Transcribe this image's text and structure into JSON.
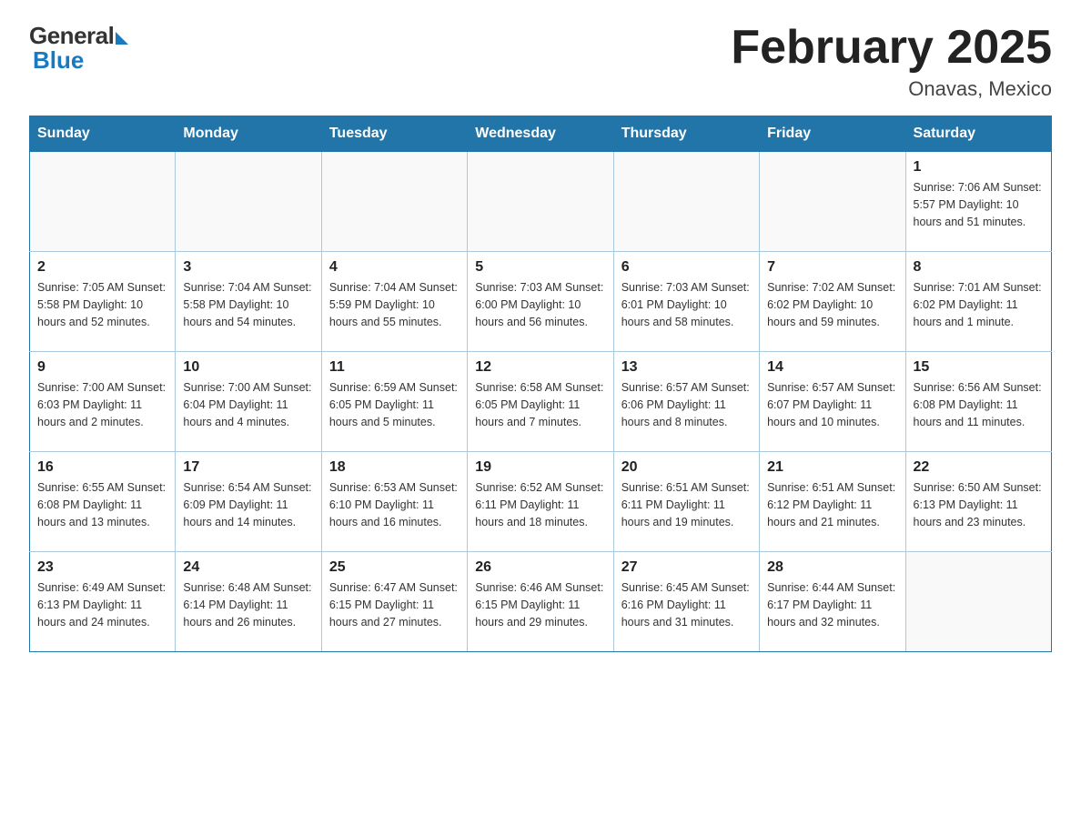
{
  "header": {
    "logo_general": "General",
    "logo_blue": "Blue",
    "month_title": "February 2025",
    "location": "Onavas, Mexico"
  },
  "days_of_week": [
    "Sunday",
    "Monday",
    "Tuesday",
    "Wednesday",
    "Thursday",
    "Friday",
    "Saturday"
  ],
  "weeks": [
    [
      {
        "day": "",
        "info": ""
      },
      {
        "day": "",
        "info": ""
      },
      {
        "day": "",
        "info": ""
      },
      {
        "day": "",
        "info": ""
      },
      {
        "day": "",
        "info": ""
      },
      {
        "day": "",
        "info": ""
      },
      {
        "day": "1",
        "info": "Sunrise: 7:06 AM\nSunset: 5:57 PM\nDaylight: 10 hours\nand 51 minutes."
      }
    ],
    [
      {
        "day": "2",
        "info": "Sunrise: 7:05 AM\nSunset: 5:58 PM\nDaylight: 10 hours\nand 52 minutes."
      },
      {
        "day": "3",
        "info": "Sunrise: 7:04 AM\nSunset: 5:58 PM\nDaylight: 10 hours\nand 54 minutes."
      },
      {
        "day": "4",
        "info": "Sunrise: 7:04 AM\nSunset: 5:59 PM\nDaylight: 10 hours\nand 55 minutes."
      },
      {
        "day": "5",
        "info": "Sunrise: 7:03 AM\nSunset: 6:00 PM\nDaylight: 10 hours\nand 56 minutes."
      },
      {
        "day": "6",
        "info": "Sunrise: 7:03 AM\nSunset: 6:01 PM\nDaylight: 10 hours\nand 58 minutes."
      },
      {
        "day": "7",
        "info": "Sunrise: 7:02 AM\nSunset: 6:02 PM\nDaylight: 10 hours\nand 59 minutes."
      },
      {
        "day": "8",
        "info": "Sunrise: 7:01 AM\nSunset: 6:02 PM\nDaylight: 11 hours\nand 1 minute."
      }
    ],
    [
      {
        "day": "9",
        "info": "Sunrise: 7:00 AM\nSunset: 6:03 PM\nDaylight: 11 hours\nand 2 minutes."
      },
      {
        "day": "10",
        "info": "Sunrise: 7:00 AM\nSunset: 6:04 PM\nDaylight: 11 hours\nand 4 minutes."
      },
      {
        "day": "11",
        "info": "Sunrise: 6:59 AM\nSunset: 6:05 PM\nDaylight: 11 hours\nand 5 minutes."
      },
      {
        "day": "12",
        "info": "Sunrise: 6:58 AM\nSunset: 6:05 PM\nDaylight: 11 hours\nand 7 minutes."
      },
      {
        "day": "13",
        "info": "Sunrise: 6:57 AM\nSunset: 6:06 PM\nDaylight: 11 hours\nand 8 minutes."
      },
      {
        "day": "14",
        "info": "Sunrise: 6:57 AM\nSunset: 6:07 PM\nDaylight: 11 hours\nand 10 minutes."
      },
      {
        "day": "15",
        "info": "Sunrise: 6:56 AM\nSunset: 6:08 PM\nDaylight: 11 hours\nand 11 minutes."
      }
    ],
    [
      {
        "day": "16",
        "info": "Sunrise: 6:55 AM\nSunset: 6:08 PM\nDaylight: 11 hours\nand 13 minutes."
      },
      {
        "day": "17",
        "info": "Sunrise: 6:54 AM\nSunset: 6:09 PM\nDaylight: 11 hours\nand 14 minutes."
      },
      {
        "day": "18",
        "info": "Sunrise: 6:53 AM\nSunset: 6:10 PM\nDaylight: 11 hours\nand 16 minutes."
      },
      {
        "day": "19",
        "info": "Sunrise: 6:52 AM\nSunset: 6:11 PM\nDaylight: 11 hours\nand 18 minutes."
      },
      {
        "day": "20",
        "info": "Sunrise: 6:51 AM\nSunset: 6:11 PM\nDaylight: 11 hours\nand 19 minutes."
      },
      {
        "day": "21",
        "info": "Sunrise: 6:51 AM\nSunset: 6:12 PM\nDaylight: 11 hours\nand 21 minutes."
      },
      {
        "day": "22",
        "info": "Sunrise: 6:50 AM\nSunset: 6:13 PM\nDaylight: 11 hours\nand 23 minutes."
      }
    ],
    [
      {
        "day": "23",
        "info": "Sunrise: 6:49 AM\nSunset: 6:13 PM\nDaylight: 11 hours\nand 24 minutes."
      },
      {
        "day": "24",
        "info": "Sunrise: 6:48 AM\nSunset: 6:14 PM\nDaylight: 11 hours\nand 26 minutes."
      },
      {
        "day": "25",
        "info": "Sunrise: 6:47 AM\nSunset: 6:15 PM\nDaylight: 11 hours\nand 27 minutes."
      },
      {
        "day": "26",
        "info": "Sunrise: 6:46 AM\nSunset: 6:15 PM\nDaylight: 11 hours\nand 29 minutes."
      },
      {
        "day": "27",
        "info": "Sunrise: 6:45 AM\nSunset: 6:16 PM\nDaylight: 11 hours\nand 31 minutes."
      },
      {
        "day": "28",
        "info": "Sunrise: 6:44 AM\nSunset: 6:17 PM\nDaylight: 11 hours\nand 32 minutes."
      },
      {
        "day": "",
        "info": ""
      }
    ]
  ]
}
